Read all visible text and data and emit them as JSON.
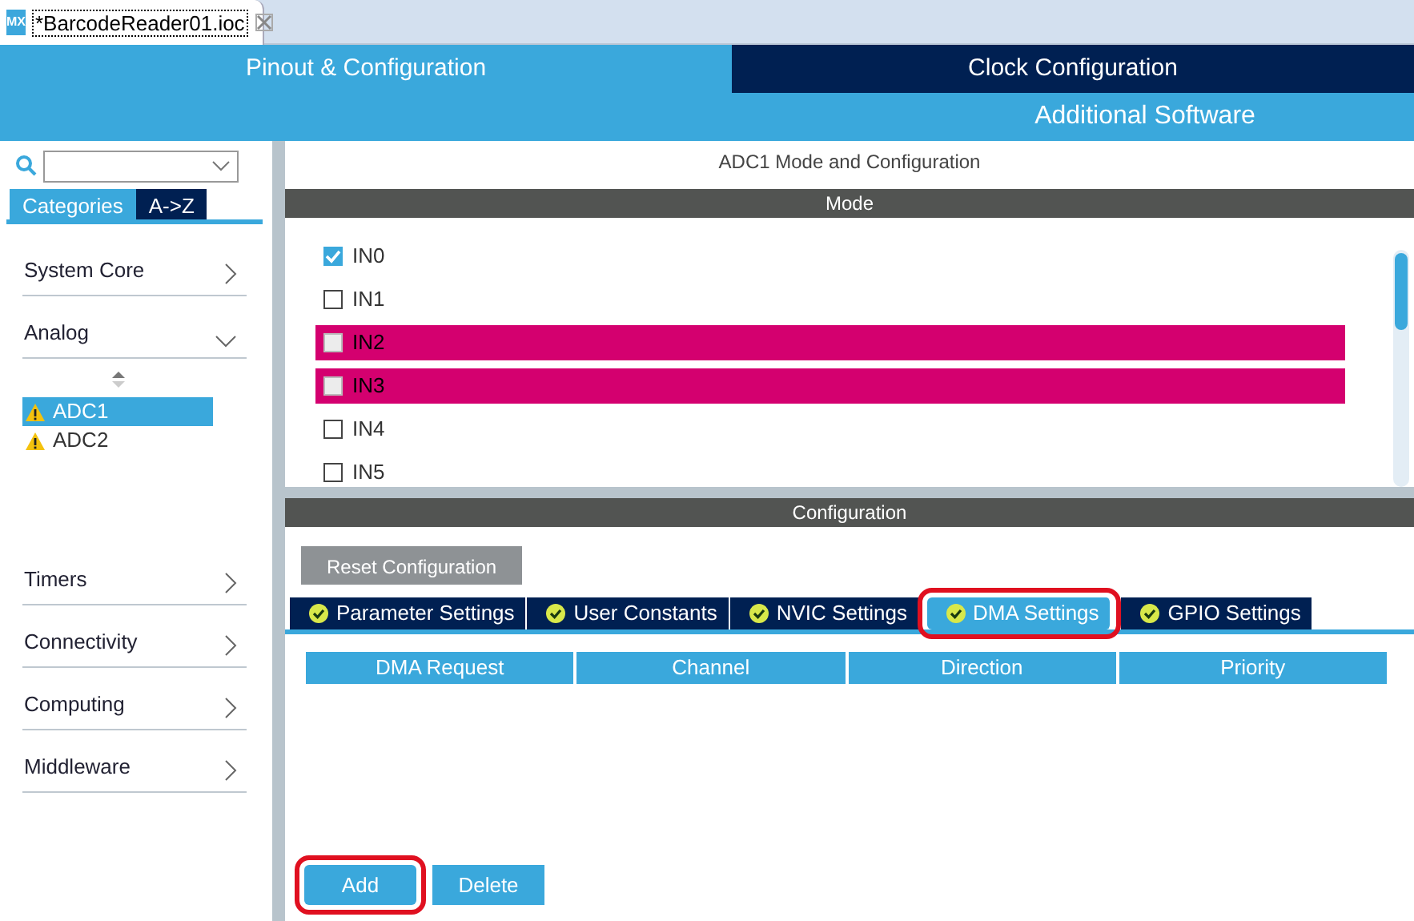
{
  "editor_tab": {
    "title": "*BarcodeReader01.ioc",
    "icon_text": "MX"
  },
  "main_tabs": [
    {
      "label": "Pinout & Configuration",
      "selected": true
    },
    {
      "label": "Clock Configuration",
      "selected": false
    }
  ],
  "additional_software": "Additional Software",
  "sidebar": {
    "view_tabs": [
      {
        "label": "Categories",
        "selected": true
      },
      {
        "label": "A->Z",
        "selected": false
      }
    ],
    "categories": [
      {
        "label": "System Core",
        "expanded": false
      },
      {
        "label": "Analog",
        "expanded": true,
        "children": [
          {
            "label": "ADC1",
            "selected": true,
            "warning": true
          },
          {
            "label": "ADC2",
            "selected": false,
            "warning": true
          }
        ]
      },
      {
        "label": "Timers",
        "expanded": false
      },
      {
        "label": "Connectivity",
        "expanded": false
      },
      {
        "label": "Computing",
        "expanded": false
      },
      {
        "label": "Middleware",
        "expanded": false
      }
    ]
  },
  "panel_title": "ADC1 Mode and Configuration",
  "mode": {
    "title": "Mode",
    "channels": [
      {
        "label": "IN0",
        "checked": true,
        "conflict": false
      },
      {
        "label": "IN1",
        "checked": false,
        "conflict": false
      },
      {
        "label": "IN2",
        "checked": false,
        "conflict": true
      },
      {
        "label": "IN3",
        "checked": false,
        "conflict": true
      },
      {
        "label": "IN4",
        "checked": false,
        "conflict": false
      },
      {
        "label": "IN5",
        "checked": false,
        "conflict": false
      }
    ]
  },
  "configuration": {
    "title": "Configuration",
    "reset_button": "Reset Configuration",
    "tabs": [
      {
        "label": "Parameter Settings",
        "selected": false,
        "circled": false
      },
      {
        "label": "User Constants",
        "selected": false,
        "circled": false
      },
      {
        "label": "NVIC Settings",
        "selected": false,
        "circled": false
      },
      {
        "label": "DMA Settings",
        "selected": true,
        "circled": true
      },
      {
        "label": "GPIO Settings",
        "selected": false,
        "circled": false
      }
    ],
    "columns": [
      "DMA Request",
      "Channel",
      "Direction",
      "Priority"
    ],
    "buttons": [
      {
        "label": "Add",
        "circled": true
      },
      {
        "label": "Delete",
        "circled": false
      }
    ]
  }
}
